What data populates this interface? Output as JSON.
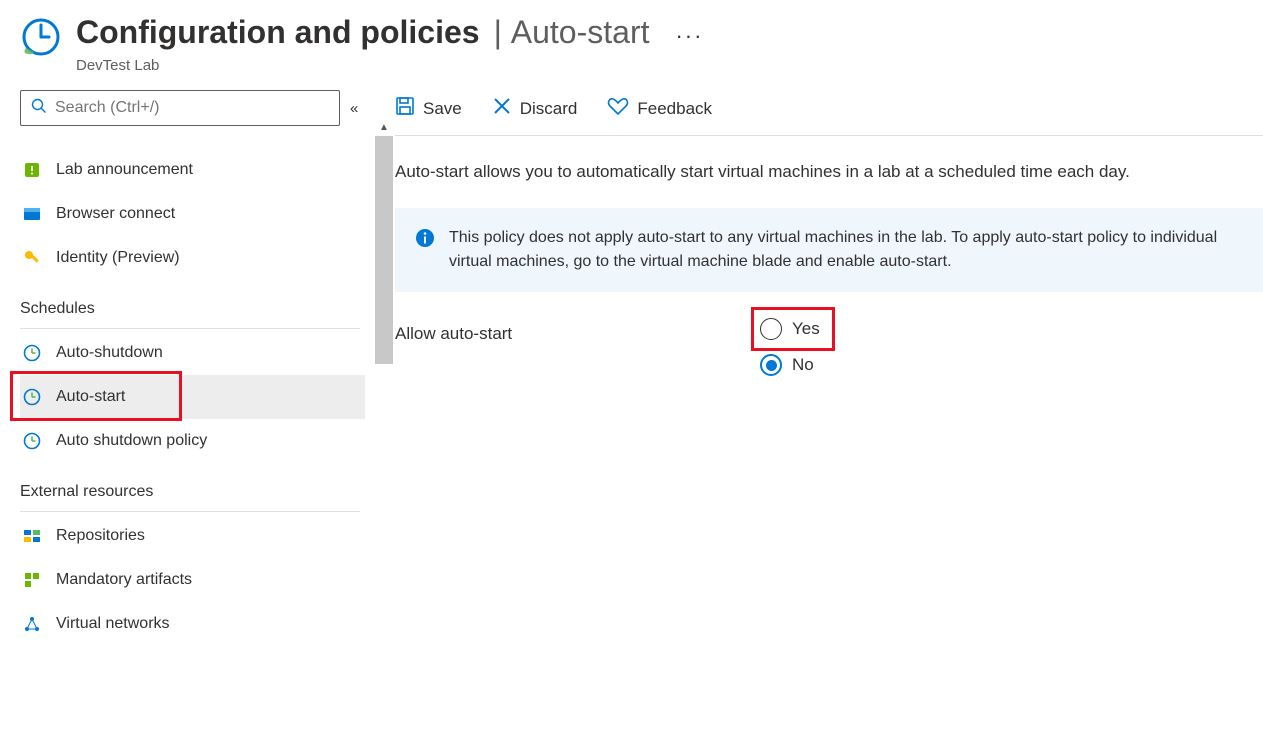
{
  "header": {
    "title": "Configuration and policies",
    "subtitle": "Auto-start",
    "resource_type": "DevTest Lab"
  },
  "search": {
    "placeholder": "Search (Ctrl+/)"
  },
  "nav": {
    "top_items": [
      {
        "label": "Lab announcement"
      },
      {
        "label": "Browser connect"
      },
      {
        "label": "Identity (Preview)"
      }
    ],
    "schedules_title": "Schedules",
    "schedules_items": [
      {
        "label": "Auto-shutdown"
      },
      {
        "label": "Auto-start"
      },
      {
        "label": "Auto shutdown policy"
      }
    ],
    "external_title": "External resources",
    "external_items": [
      {
        "label": "Repositories"
      },
      {
        "label": "Mandatory artifacts"
      },
      {
        "label": "Virtual networks"
      }
    ]
  },
  "toolbar": {
    "save_label": "Save",
    "discard_label": "Discard",
    "feedback_label": "Feedback"
  },
  "content": {
    "description": "Auto-start allows you to automatically start virtual machines in a lab at a scheduled time each day.",
    "info": "This policy does not apply auto-start to any virtual machines in the lab. To apply auto-start policy to individual virtual machines, go to the virtual machine blade and enable auto-start.",
    "setting_label": "Allow auto-start",
    "option_yes": "Yes",
    "option_no": "No"
  }
}
